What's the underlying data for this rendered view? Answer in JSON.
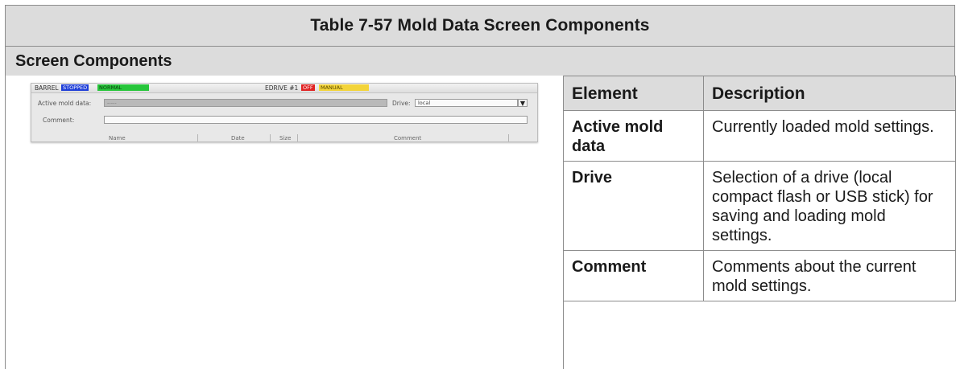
{
  "title": "Table 7-57 Mold Data Screen Components",
  "section": "Screen Components",
  "thumbnail": {
    "statusbar": {
      "barrel_label": "BARREL",
      "barrel_state": "STOPPED",
      "barrel_mode": "NORMAL",
      "edrive_label": "EDRIVE #1",
      "edrive_state": "OFF",
      "edrive_mode": "MANUAL"
    },
    "active_mold_label": "Active mold data:",
    "active_mold_value": "-----",
    "drive_label": "Drive:",
    "drive_value": "local",
    "comment_label": "Comment:",
    "columns": [
      "Name",
      "Date",
      "Size",
      "Comment"
    ],
    "colors": {
      "stopped": "#1f3fd8",
      "normal": "#27c63b",
      "off": "#e02424",
      "manual": "#f3d43a"
    }
  },
  "components_table": {
    "headers": [
      "Element",
      "Description"
    ],
    "rows": [
      {
        "element": "Active mold data",
        "description": "Currently loaded mold settings."
      },
      {
        "element": "Drive",
        "description": "Selection of a drive (local compact flash or USB stick) for saving and loading mold settings."
      },
      {
        "element": "Comment",
        "description": "Comments about the current mold settings."
      }
    ]
  },
  "colors": {
    "header_bg": "#dcdcdc",
    "border": "#8c8c8c"
  }
}
